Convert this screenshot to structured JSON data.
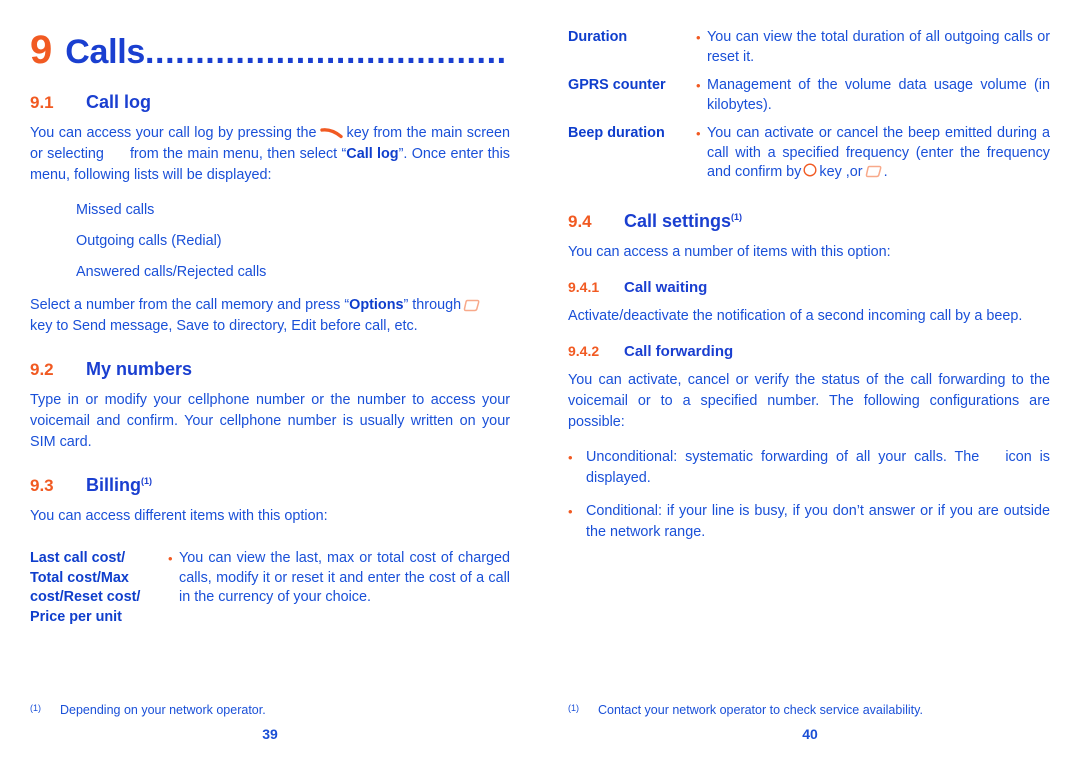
{
  "document": {
    "chapter_number": "9",
    "chapter_title": "Calls",
    "chapter_dots": "...................................."
  },
  "left_page": {
    "page_number": "39",
    "sections": {
      "call_log": {
        "number": "9.1",
        "title": "Call log",
        "para_1_part_a": "You can access your call log by pressing the",
        "para_1_part_b": "key from the main screen or selecting",
        "para_1_part_c": "from the main menu, then select “",
        "para_1_bold": "Call log",
        "para_1_part_d": "”. Once enter this menu, following lists will be displayed:",
        "list": [
          "Missed calls",
          "Outgoing calls (Redial)",
          "Answered calls/Rejected calls"
        ],
        "para_2_part_a": "Select a number from the call memory and press “",
        "para_2_bold": "Options",
        "para_2_part_b": "” through",
        "para_2_part_c": "key to Send message, Save to directory, Edit before call, etc."
      },
      "my_numbers": {
        "number": "9.2",
        "title": "My numbers",
        "paragraph": "Type in or modify your cellphone number or the number to access your voicemail and confirm. Your cellphone number is usually written on your SIM card."
      },
      "billing": {
        "number": "9.3",
        "title": "Billing",
        "footnote_marker": "(1)",
        "intro": "You can access different items with this option:",
        "rows": [
          {
            "term": "Last call cost/ Total cost/Max cost/Reset cost/ Price per unit",
            "bullet": "•",
            "description": "You can view the last, max or total cost of charged calls, modify it or reset it and enter the cost of a call in the currency of your choice."
          }
        ]
      }
    },
    "footnote": {
      "marker": "(1)",
      "text": "Depending on your network operator."
    }
  },
  "right_page": {
    "page_number": "40",
    "billing_rows_continued": [
      {
        "term": "Duration",
        "bullet": "•",
        "description": "You can view the total duration of all outgoing calls or reset it."
      },
      {
        "term": "GPRS counter",
        "bullet": "•",
        "description": "Management of the volume data usage volume (in kilobytes)."
      },
      {
        "term": "Beep duration",
        "bullet": "•",
        "description_part_a": "You can activate or cancel the beep emitted during a call with a specified frequency (enter the frequency and confirm by",
        "description_part_b": "key ,or",
        "description_part_c": "."
      }
    ],
    "sections": {
      "call_settings": {
        "number": "9.4",
        "title": "Call settings",
        "footnote_marker": "(1)",
        "intro": "You can access a number of items with this option:",
        "call_waiting": {
          "number": "9.4.1",
          "title": "Call waiting",
          "paragraph": "Activate/deactivate the notification of a second incoming call by a beep."
        },
        "call_forwarding": {
          "number": "9.4.2",
          "title": "Call forwarding",
          "paragraph": "You can activate, cancel or verify the status of the call forwarding to the voicemail or to a specified number. The following configurations are possible:",
          "bullets": [
            {
              "marker": "•",
              "text_part_a": "Unconditional: systematic forwarding of all your calls. The",
              "text_part_b": "icon is displayed."
            },
            {
              "marker": "•",
              "text_part_a": "Conditional: if your line is busy, if you don’t answer or if you are outside the network range.",
              "text_part_b": ""
            }
          ]
        }
      }
    },
    "footnote": {
      "marker": "(1)",
      "text": "Contact your network operator to check service availability."
    }
  },
  "colors": {
    "heading_blue": "#1a3fd0",
    "body_blue": "#1a50d8",
    "accent_orange": "#f15a22",
    "icon_salmon": "#f8a98a"
  }
}
